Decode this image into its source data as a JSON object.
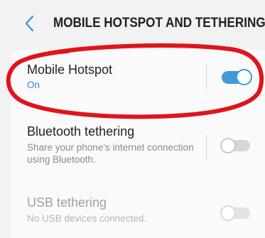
{
  "header": {
    "title": "MOBILE HOTSPOT AND TETHERING",
    "back_icon": "chevron-left-icon"
  },
  "settings": [
    {
      "title": "Mobile Hotspot",
      "subtitle": "On",
      "enabled": true
    },
    {
      "title": "Bluetooth tethering",
      "subtitle": "Share your phone's internet connection using Bluetooth.",
      "enabled": false
    },
    {
      "title": "USB tethering",
      "subtitle": "No USB devices connected.",
      "enabled": false
    }
  ],
  "colors": {
    "accent": "#3f9ad9",
    "annotation": "#e0141a",
    "background": "#f2f2f2"
  }
}
